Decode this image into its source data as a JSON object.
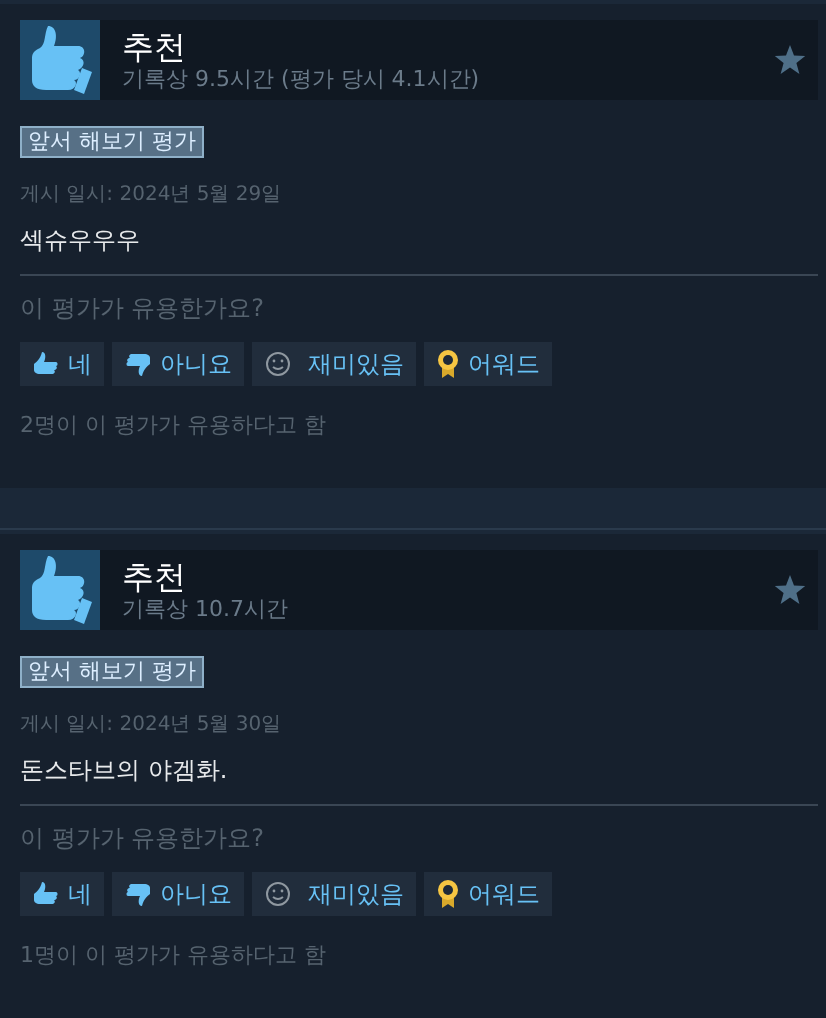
{
  "reviews": [
    {
      "verdict": "추천",
      "hours": "기록상 9.5시간 (평가 당시 4.1시간)",
      "tag": "앞서 해보기 평가",
      "date": "게시 일시: 2024년 5월 29일",
      "text": "섹슈우우우",
      "question": "이 평가가 유용한가요?",
      "buttons": [
        {
          "kind": "yes",
          "label": "네"
        },
        {
          "kind": "no",
          "label": "아니요"
        },
        {
          "kind": "funny",
          "label": "재미있음"
        },
        {
          "kind": "award",
          "label": "어워드"
        }
      ],
      "helpful": "2명이 이 평가가 유용하다고 함"
    },
    {
      "verdict": "추천",
      "hours": "기록상 10.7시간",
      "tag": "앞서 해보기 평가",
      "date": "게시 일시: 2024년 5월 30일",
      "text": "돈스타브의 야겜화.",
      "question": "이 평가가 유용한가요?",
      "buttons": [
        {
          "kind": "yes",
          "label": "네"
        },
        {
          "kind": "no",
          "label": "아니요"
        },
        {
          "kind": "funny",
          "label": "재미있음"
        },
        {
          "kind": "award",
          "label": "어워드"
        }
      ],
      "helpful": "1명이 이 평가가 유용하다고 함"
    }
  ]
}
